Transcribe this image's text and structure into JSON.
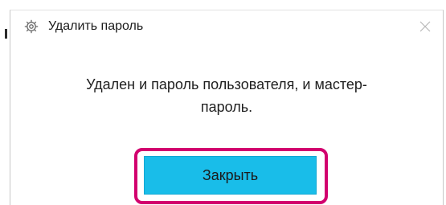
{
  "dialog": {
    "title": "Удалить пароль",
    "message_line1": "Удален и пароль пользователя, и мастер-",
    "message_line2": "пароль.",
    "close_button_label": "Закрыть",
    "app_icon": "gear-icon",
    "close_icon": "close-icon"
  },
  "colors": {
    "button_fill": "#19bde9",
    "focus_ring": "#d2006e"
  }
}
